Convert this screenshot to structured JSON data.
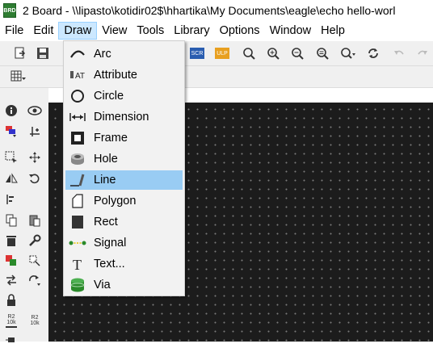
{
  "window": {
    "title": "2 Board - \\\\lipasto\\kotidir02$\\hhartika\\My Documents\\eagle\\echo hello-worl",
    "app_icon_text": "BRD"
  },
  "menubar": [
    "File",
    "Edit",
    "Draw",
    "View",
    "Tools",
    "Library",
    "Options",
    "Window",
    "Help"
  ],
  "active_menu": "Draw",
  "draw_menu": {
    "items": [
      {
        "label": "Arc",
        "icon": "arc-icon"
      },
      {
        "label": "Attribute",
        "icon": "attribute-icon"
      },
      {
        "label": "Circle",
        "icon": "circle-icon"
      },
      {
        "label": "Dimension",
        "icon": "dimension-icon"
      },
      {
        "label": "Frame",
        "icon": "frame-icon"
      },
      {
        "label": "Hole",
        "icon": "hole-icon"
      },
      {
        "label": "Line",
        "icon": "line-icon",
        "highlighted": true
      },
      {
        "label": "Polygon",
        "icon": "polygon-icon"
      },
      {
        "label": "Rect",
        "icon": "rect-icon"
      },
      {
        "label": "Signal",
        "icon": "signal-icon"
      },
      {
        "label": "Text...",
        "icon": "text-icon"
      },
      {
        "label": "Via",
        "icon": "via-icon"
      }
    ]
  },
  "toolbar": {
    "script_label": "SCR",
    "ulp_label": "ULP"
  },
  "leftbar": {
    "label_r2_10k": "R2\n10k",
    "label_r2_10k_b": "R2\n10k"
  },
  "colors": {
    "canvas": "#1c1c1c",
    "grid_dot": "#7a7a7a",
    "highlight": "#99ccf3",
    "menu_active": "#cce8ff"
  }
}
